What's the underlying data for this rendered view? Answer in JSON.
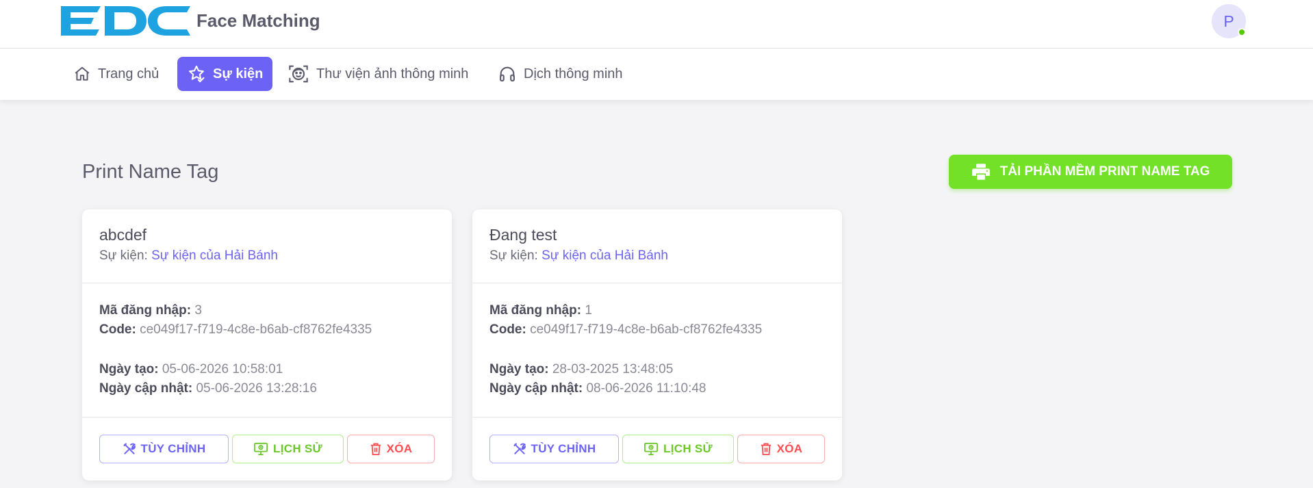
{
  "header": {
    "logo_text": "EDC",
    "app_title": "Face Matching",
    "avatar_initial": "P"
  },
  "nav": {
    "items": [
      {
        "label": "Trang chủ",
        "icon": "home-icon",
        "active": false
      },
      {
        "label": "Sự kiện",
        "icon": "star-check-icon",
        "active": true
      },
      {
        "label": "Thư viện ảnh thông minh",
        "icon": "face-scan-icon",
        "active": false
      },
      {
        "label": "Dịch thông minh",
        "icon": "headphones-icon",
        "active": false
      }
    ]
  },
  "page": {
    "title": "Print Name Tag",
    "download_button": "TẢI PHẦN MỀM PRINT NAME TAG"
  },
  "labels": {
    "event": "Sự kiện:",
    "login_code": "Mã đăng nhập:",
    "code": "Code:",
    "created": "Ngày tạo:",
    "updated": "Ngày cập nhật:",
    "edit_button": "TÙY CHỈNH",
    "history_button": "LỊCH SỬ",
    "delete_button": "XÓA"
  },
  "cards": [
    {
      "title": "abcdef",
      "event_name": "Sự kiện của Hải Bánh",
      "login_code": "3",
      "code": "ce049f17-f719-4c8e-b6ab-cf8762fe4335",
      "created": "05-06-2026 10:58:01",
      "updated": "05-06-2026 13:28:16"
    },
    {
      "title": "Đang test",
      "event_name": "Sự kiện của Hải Bánh",
      "login_code": "1",
      "code": "ce049f17-f719-4c8e-b6ab-cf8762fe4335",
      "created": "28-03-2025 13:48:05",
      "updated": "08-06-2026 11:10:48"
    }
  ],
  "colors": {
    "primary": "#6c63f6",
    "success": "#72e128",
    "danger": "#ff4c51",
    "logo": "#1fa3e0"
  }
}
